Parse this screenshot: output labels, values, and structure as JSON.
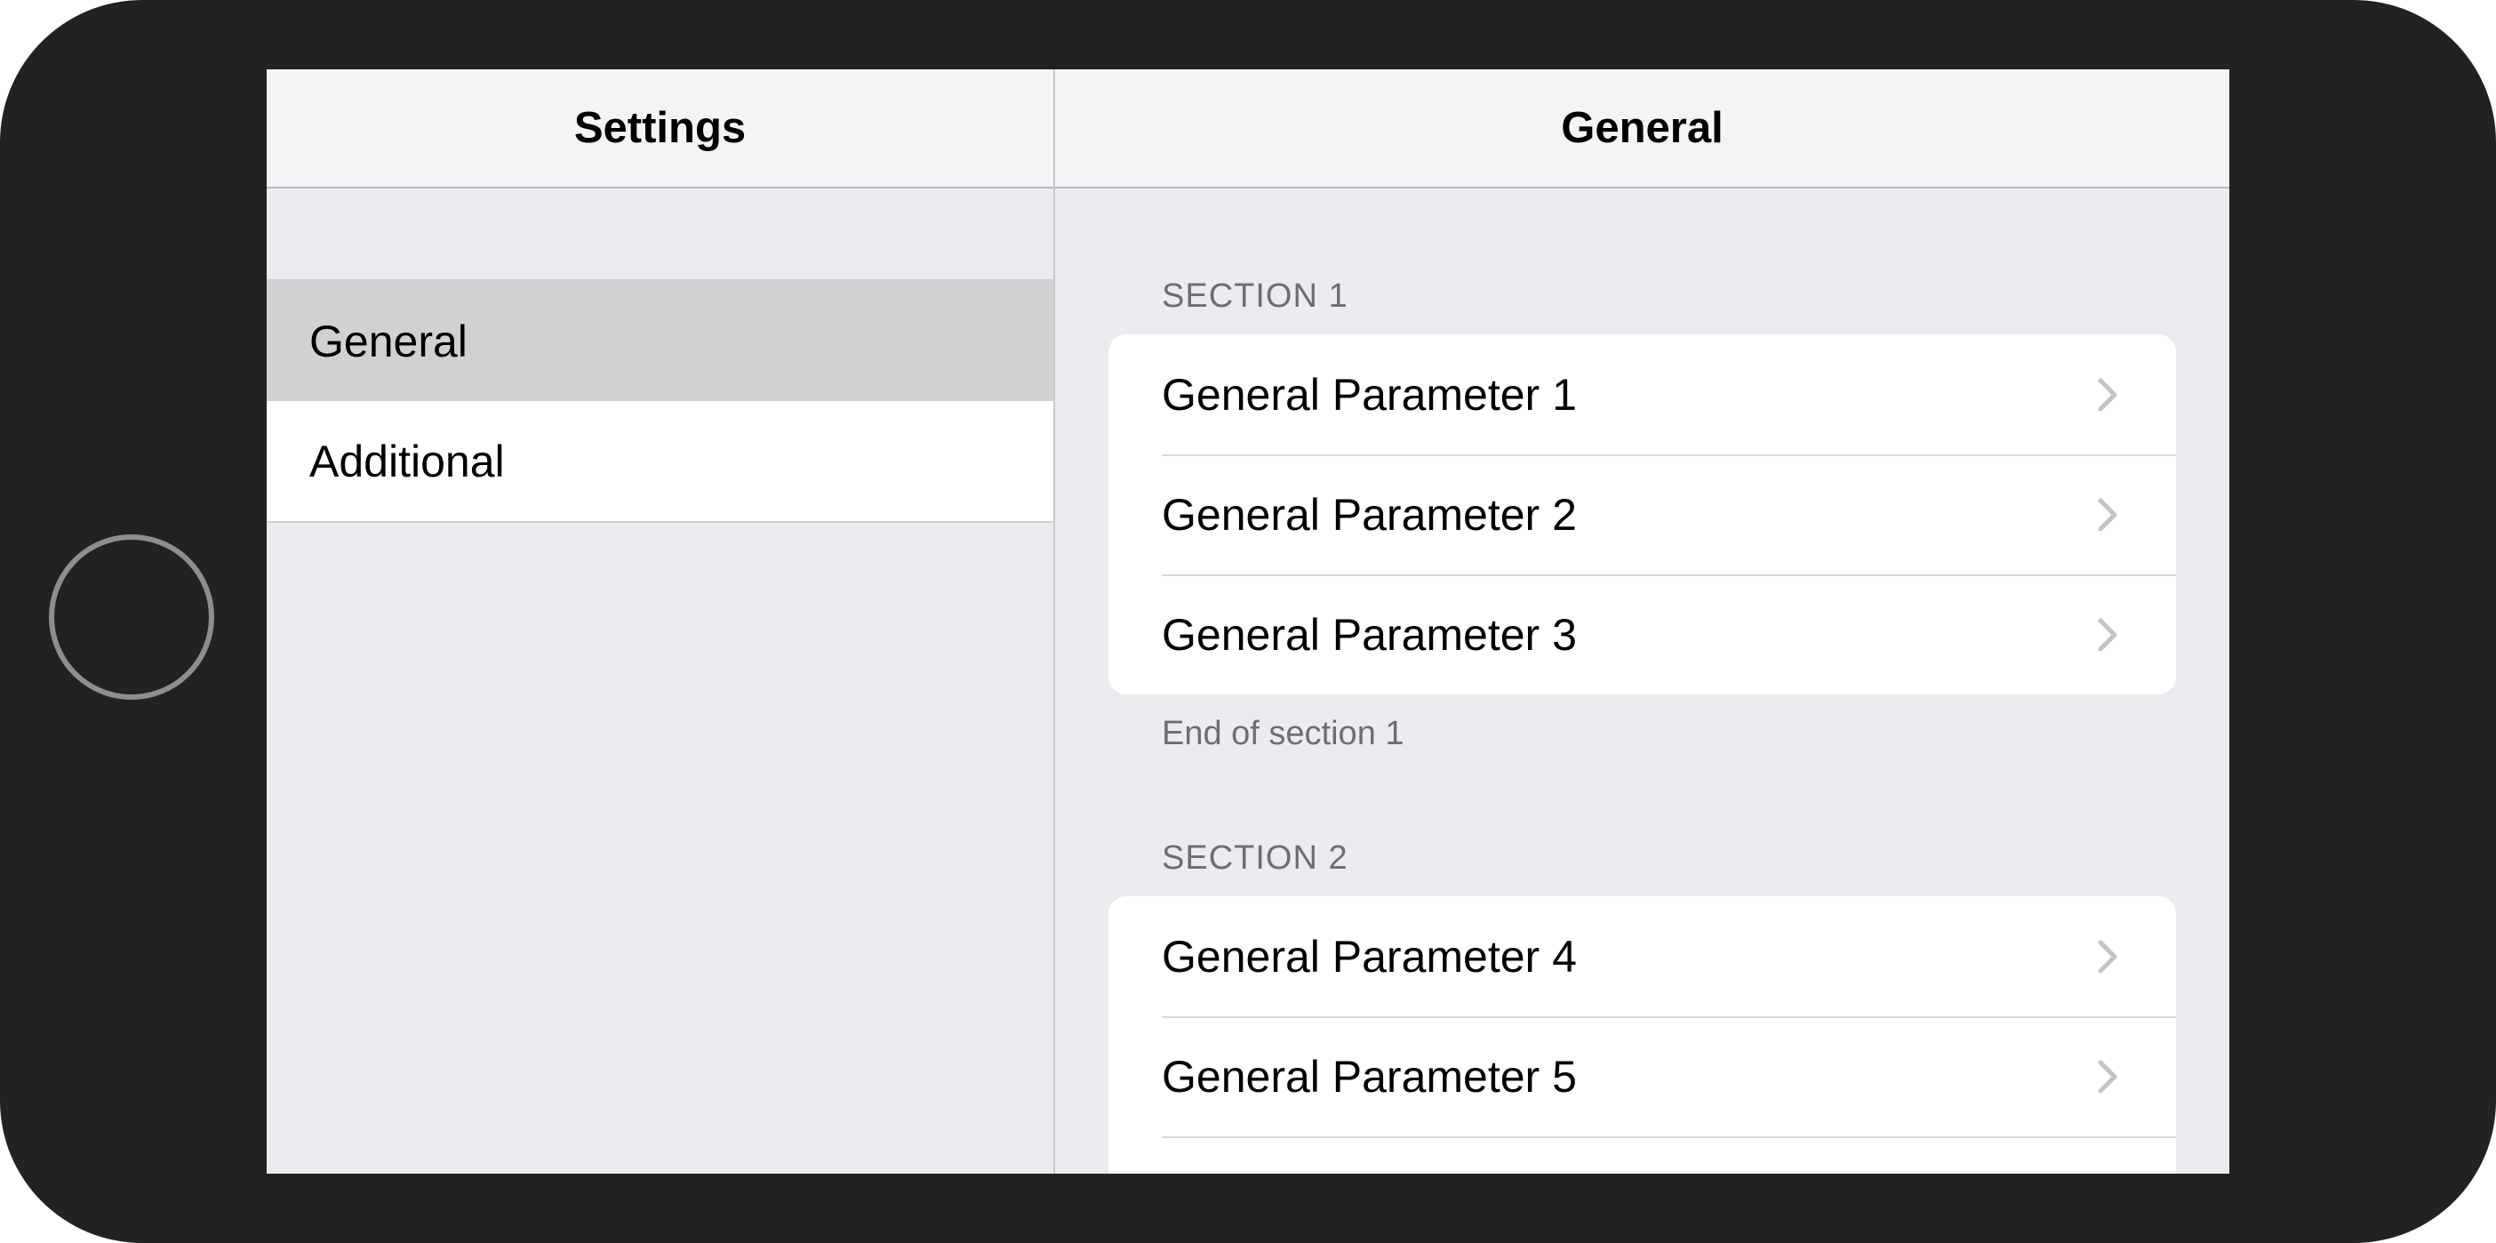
{
  "master": {
    "title": "Settings",
    "items": [
      {
        "label": "General",
        "selected": true
      },
      {
        "label": "Additional",
        "selected": false
      }
    ]
  },
  "detail": {
    "title": "General",
    "sections": [
      {
        "header": "SECTION 1",
        "footer": "End of section 1",
        "rows": [
          "General Parameter 1",
          "General Parameter 2",
          "General Parameter 3"
        ]
      },
      {
        "header": "SECTION 2",
        "rows": [
          "General Parameter 4",
          "General Parameter 5"
        ]
      }
    ]
  },
  "icons": {
    "row_accessory": "chevron-right-icon",
    "home": "home-button"
  },
  "colors": {
    "selected_row": "#d1d1d3",
    "grouped_background": "#ebebf0",
    "secondary_text": "#6d6d72",
    "chevron": "#c4c4c7",
    "device_frame": "#222222"
  }
}
